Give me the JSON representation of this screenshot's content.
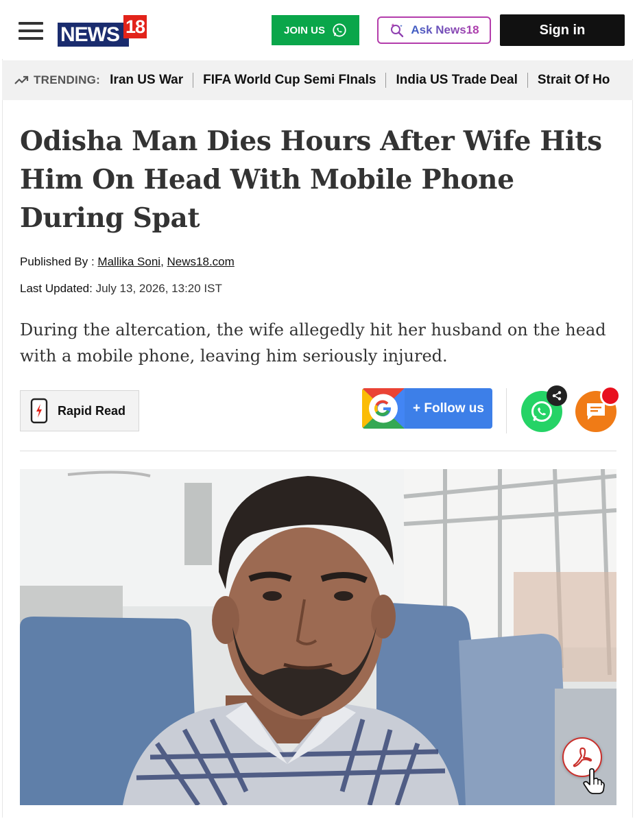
{
  "header": {
    "logo_text": "NEWS",
    "logo_number": "18",
    "join_label": "JOIN US",
    "ask_label": "Ask News18",
    "signin_label": "Sign in"
  },
  "trending": {
    "label": "TRENDING:",
    "items": [
      "Iran US War",
      "FIFA World Cup Semi FInals",
      "India US Trade Deal",
      "Strait Of Ho"
    ]
  },
  "article": {
    "headline": "Odisha Man Dies Hours After Wife Hits Him On Head With Mobile Phone During Spat",
    "published_by_label": "Published By :",
    "author": "Mallika Soni",
    "outlet": "News18.com",
    "last_updated_label": "Last Updated:",
    "last_updated_value": "July 13, 2026, 13:20 IST",
    "summary": "During the altercation, the wife allegedly hit her husband on the head with a mobile phone, leaving him seriously injured."
  },
  "actions": {
    "rapid_read_label": "Rapid Read",
    "follow_label": "+ Follow us"
  },
  "icons": {
    "menu": "hamburger-menu-icon",
    "whatsapp": "whatsapp-icon",
    "sparkle_search": "sparkle-search-icon",
    "trending": "trending-arrow-icon",
    "rapid": "phone-lightning-icon",
    "google": "google-icon",
    "share": "share-icon",
    "comment": "comment-icon",
    "pdf": "pdf-icon"
  },
  "colors": {
    "brand_navy": "#1a2c6e",
    "brand_red": "#e2231a",
    "join_green": "#0aa64a",
    "follow_blue": "#3d7fe8",
    "whatsapp_green": "#25d366",
    "comment_orange": "#f07b16"
  }
}
